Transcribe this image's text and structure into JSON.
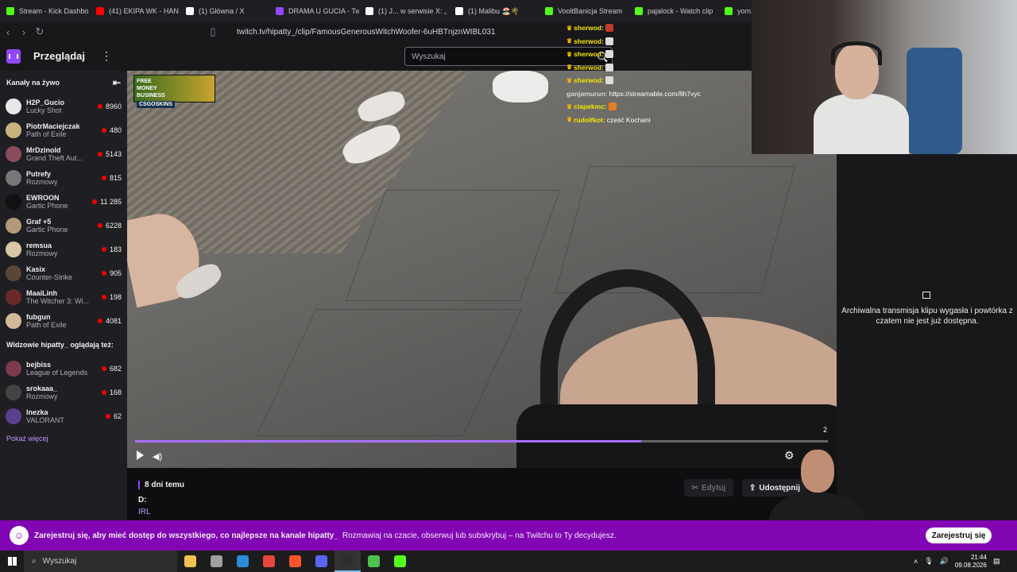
{
  "browser": {
    "tabs": [
      {
        "title": "Stream - Kick Dashbo",
        "icon": "kick-icon",
        "color": "#53fc18"
      },
      {
        "title": "(41) EKIPA WK - HAN",
        "icon": "youtube-icon",
        "color": "#ff0000"
      },
      {
        "title": "(1) Główna / X",
        "icon": "x-icon",
        "color": "#ffffff"
      },
      {
        "title": "DRAMA U GUCIA - Tw",
        "icon": "twitch-icon",
        "color": "#9147ff"
      },
      {
        "title": "(1) J... w serwisie X: „",
        "icon": "x-icon",
        "color": "#ffffff"
      },
      {
        "title": "(1) Malibu 🏖️🌴",
        "icon": "x-icon",
        "color": "#ffffff"
      },
      {
        "title": "VooltBanicja Stream",
        "icon": "kick-icon",
        "color": "#53fc18"
      },
      {
        "title": "pajalock - Watch clip",
        "icon": "kick-icon",
        "color": "#53fc18"
      },
      {
        "title": "yom1s",
        "icon": "kick-icon",
        "color": "#53fc18"
      }
    ],
    "url": "twitch.tv/hipatty_/clip/FamousGenerousWitchWoofer-6uHBTnjznWIBL031"
  },
  "topnav": {
    "browse_label": "Przeglądaj",
    "search_placeholder": "Wyszukaj"
  },
  "sidebar": {
    "live_header": "Kanały na żywo",
    "live_channels": [
      {
        "name": "H2P_Gucio",
        "game": "Lucky Shot",
        "viewers": "8960",
        "color": "#e8e8e8"
      },
      {
        "name": "PiotrMaciejczak",
        "game": "Path of Exile",
        "viewers": "480",
        "color": "#c9b27d"
      },
      {
        "name": "MrDzinold",
        "game": "Grand Theft Aut...",
        "viewers": "5143",
        "color": "#8a4b5c"
      },
      {
        "name": "Putrefy",
        "game": "Rozmowy",
        "viewers": "815",
        "color": "#777777"
      },
      {
        "name": "EWROON",
        "game": "Gartic Phone",
        "viewers": "11 285",
        "color": "#111111"
      },
      {
        "name": "Graf +5",
        "game": "Gartic Phone",
        "viewers": "6228",
        "color": "#b39a78"
      },
      {
        "name": "remsua",
        "game": "Rozmowy",
        "viewers": "183",
        "color": "#d9c7a7"
      },
      {
        "name": "Kasix",
        "game": "Counter-Strike",
        "viewers": "905",
        "color": "#5a4636"
      },
      {
        "name": "MaaiLinh",
        "game": "The Witcher 3: Wi...",
        "viewers": "198",
        "color": "#6a2a2a"
      },
      {
        "name": "fubgun",
        "game": "Path of Exile",
        "viewers": "4081",
        "color": "#d3b89a"
      }
    ],
    "rec_header": "Widzowie hipatty_ oglądają też:",
    "rec_channels": [
      {
        "name": "bejbiss",
        "game": "League of Legends",
        "viewers": "682",
        "color": "#7c3b4d"
      },
      {
        "name": "srokaaa_",
        "game": "Rozmowy",
        "viewers": "168",
        "color": "#444444"
      },
      {
        "name": "lnezka",
        "game": "VALORANT",
        "viewers": "62",
        "color": "#5c3f8f"
      }
    ],
    "show_more": "Pokaż więcej"
  },
  "video": {
    "ad_line1": "FREE",
    "ad_line2": "MONEY",
    "ad_line3": "BUSINESS",
    "ad_brand": "CSGOSKINS",
    "progress": 0.73,
    "progress_num": "2"
  },
  "chat": [
    {
      "user": "sherwod:",
      "text": "",
      "badge": true,
      "emote": "#c0392b",
      "user_class": "u"
    },
    {
      "user": "sherwod:",
      "text": "",
      "badge": true,
      "emote": "#dddddd",
      "user_class": "u"
    },
    {
      "user": "sherwod:",
      "text": "",
      "badge": true,
      "emote": "#dddddd",
      "user_class": "u"
    },
    {
      "user": "sherwod:",
      "text": "",
      "badge": true,
      "emote": "#dddddd",
      "user_class": "u"
    },
    {
      "user": "sherwod:",
      "text": "",
      "badge": true,
      "emote": "#dddddd",
      "user_class": "u"
    },
    {
      "user": "ganjamurun:",
      "text": "https://streamable.com/8h7vyc",
      "badge": false,
      "emote": "",
      "user_class": "u2"
    },
    {
      "user": "ciapekmc:",
      "text": "",
      "badge": true,
      "emote": "#e67e22",
      "user_class": "u"
    },
    {
      "user": "rudolfkot:",
      "text": "cześć Kochani",
      "badge": true,
      "emote": "",
      "user_class": "u"
    }
  ],
  "right_panel": {
    "archived_text": "Archiwalna transmisja klipu wygasła i powtórka z czatem nie jest już dostępna."
  },
  "clip_info": {
    "age": "8 dni temu",
    "title": "D:",
    "tag": "IRL",
    "edit_label": "Edytuj",
    "share_label": "Udostępnij"
  },
  "banner": {
    "bold": "Zarejestruj się, aby mieć dostęp do wszystkiego, co najlepsze na kanale hipatty_",
    "text": "Rozmawiaj na czacie, obserwuj lub subskrybuj – na Twitchu to Ty decydujesz.",
    "signup_label": "Zarejestruj się"
  },
  "taskbar": {
    "search_placeholder": "Wyszukaj",
    "apps": [
      {
        "name": "file-explorer-icon",
        "color": "#f2c14e"
      },
      {
        "name": "photos-icon",
        "color": "#a0a0a0"
      },
      {
        "name": "edge-icon",
        "color": "#2a8bd8"
      },
      {
        "name": "chrome-icon",
        "color": "#e8453c"
      },
      {
        "name": "brave-icon",
        "color": "#fb542b"
      },
      {
        "name": "discord-icon",
        "color": "#5865f2"
      },
      {
        "name": "obs-icon",
        "color": "#302e31"
      },
      {
        "name": "app-green-icon",
        "color": "#4ec04e"
      },
      {
        "name": "kick-app-icon",
        "color": "#53fc18"
      }
    ],
    "time": "21:44",
    "date": "09.08.2026"
  }
}
